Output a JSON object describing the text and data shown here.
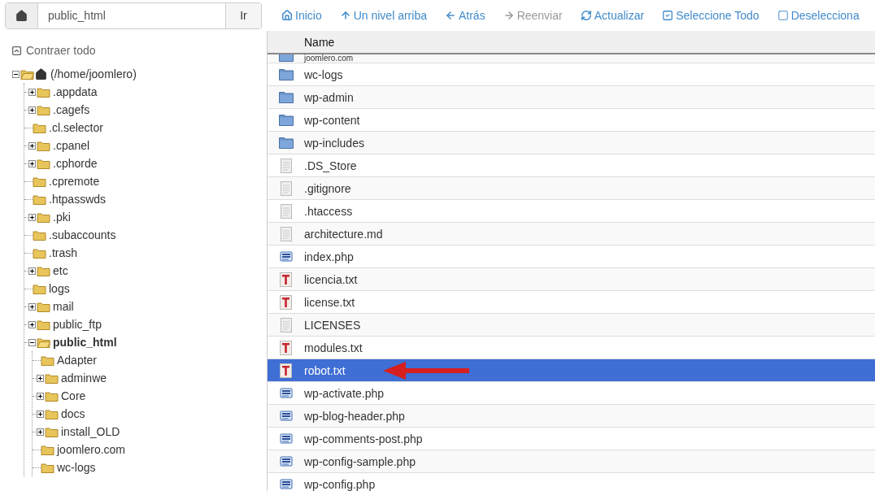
{
  "toolbar": {
    "path": {
      "value": "public_html"
    },
    "go_button": "Ir",
    "actions": [
      {
        "kind": "home",
        "label": "Inicio",
        "disabled": false
      },
      {
        "kind": "up",
        "label": "Un nivel arriba",
        "disabled": false
      },
      {
        "kind": "back",
        "label": "Atrás",
        "disabled": false
      },
      {
        "kind": "forward",
        "label": "Reenviar",
        "disabled": true
      },
      {
        "kind": "reload",
        "label": "Actualizar",
        "disabled": false
      },
      {
        "kind": "select_all",
        "label": "Seleccione Todo",
        "disabled": false
      },
      {
        "kind": "deselect",
        "label": "Deselecciona",
        "disabled": false
      }
    ]
  },
  "tree": {
    "collapse_all": "Contraer todo",
    "root": {
      "label": "(/home/joomlero)",
      "kind": "branch",
      "expanded": true,
      "selected": false,
      "children": [
        {
          "label": ".appdata",
          "kind": "branch",
          "expanded": false,
          "selected": false
        },
        {
          "label": ".cagefs",
          "kind": "branch",
          "expanded": false,
          "selected": false
        },
        {
          "label": ".cl.selector",
          "kind": "leaf",
          "expanded": false,
          "selected": false
        },
        {
          "label": ".cpanel",
          "kind": "branch",
          "expanded": false,
          "selected": false
        },
        {
          "label": ".cphorde",
          "kind": "branch",
          "expanded": false,
          "selected": false
        },
        {
          "label": ".cpremote",
          "kind": "leaf",
          "expanded": false,
          "selected": false
        },
        {
          "label": ".htpasswds",
          "kind": "leaf",
          "expanded": false,
          "selected": false
        },
        {
          "label": ".pki",
          "kind": "branch",
          "expanded": false,
          "selected": false
        },
        {
          "label": ".subaccounts",
          "kind": "leaf",
          "expanded": false,
          "selected": false
        },
        {
          "label": ".trash",
          "kind": "leaf",
          "expanded": false,
          "selected": false
        },
        {
          "label": "etc",
          "kind": "branch",
          "expanded": false,
          "selected": false
        },
        {
          "label": "logs",
          "kind": "leaf",
          "expanded": false,
          "selected": false
        },
        {
          "label": "mail",
          "kind": "branch",
          "expanded": false,
          "selected": false
        },
        {
          "label": "public_ftp",
          "kind": "branch",
          "expanded": false,
          "selected": false
        },
        {
          "label": "public_html",
          "kind": "branch",
          "expanded": true,
          "selected": true,
          "children": [
            {
              "label": "Adapter",
              "kind": "leaf",
              "expanded": false,
              "selected": false
            },
            {
              "label": "adminwe",
              "kind": "branch",
              "expanded": false,
              "selected": false
            },
            {
              "label": "Core",
              "kind": "branch",
              "expanded": false,
              "selected": false
            },
            {
              "label": "docs",
              "kind": "branch",
              "expanded": false,
              "selected": false
            },
            {
              "label": "install_OLD",
              "kind": "branch",
              "expanded": false,
              "selected": false
            },
            {
              "label": "joomlero.com",
              "kind": "leaf",
              "expanded": false,
              "selected": false
            },
            {
              "label": "wc-logs",
              "kind": "leaf",
              "expanded": false,
              "selected": false
            }
          ]
        }
      ]
    }
  },
  "table": {
    "columns": [
      "Name"
    ],
    "rows": [
      {
        "name": "joomlero.com",
        "kind": "folder",
        "selected": false,
        "annotated": false,
        "partial": true
      },
      {
        "name": "wc-logs",
        "kind": "folder",
        "selected": false,
        "annotated": false,
        "partial": false
      },
      {
        "name": "wp-admin",
        "kind": "folder",
        "selected": false,
        "annotated": false,
        "partial": false
      },
      {
        "name": "wp-content",
        "kind": "folder",
        "selected": false,
        "annotated": false,
        "partial": false
      },
      {
        "name": "wp-includes",
        "kind": "folder",
        "selected": false,
        "annotated": false,
        "partial": false
      },
      {
        "name": ".DS_Store",
        "kind": "file",
        "selected": false,
        "annotated": false,
        "partial": false
      },
      {
        "name": ".gitignore",
        "kind": "file",
        "selected": false,
        "annotated": false,
        "partial": false
      },
      {
        "name": ".htaccess",
        "kind": "file",
        "selected": false,
        "annotated": false,
        "partial": false
      },
      {
        "name": "architecture.md",
        "kind": "file",
        "selected": false,
        "annotated": false,
        "partial": false
      },
      {
        "name": "index.php",
        "kind": "php",
        "selected": false,
        "annotated": false,
        "partial": false
      },
      {
        "name": "licencia.txt",
        "kind": "text",
        "selected": false,
        "annotated": false,
        "partial": false
      },
      {
        "name": "license.txt",
        "kind": "text",
        "selected": false,
        "annotated": false,
        "partial": false
      },
      {
        "name": "LICENSES",
        "kind": "file",
        "selected": false,
        "annotated": false,
        "partial": false
      },
      {
        "name": "modules.txt",
        "kind": "text",
        "selected": false,
        "annotated": false,
        "partial": false
      },
      {
        "name": "robot.txt",
        "kind": "text",
        "selected": true,
        "annotated": true,
        "partial": false
      },
      {
        "name": "wp-activate.php",
        "kind": "php",
        "selected": false,
        "annotated": false,
        "partial": false
      },
      {
        "name": "wp-blog-header.php",
        "kind": "php",
        "selected": false,
        "annotated": false,
        "partial": false
      },
      {
        "name": "wp-comments-post.php",
        "kind": "php",
        "selected": false,
        "annotated": false,
        "partial": false
      },
      {
        "name": "wp-config-sample.php",
        "kind": "php",
        "selected": false,
        "annotated": false,
        "partial": false
      },
      {
        "name": "wp-config.php",
        "kind": "php",
        "selected": false,
        "annotated": false,
        "partial": false
      }
    ]
  }
}
